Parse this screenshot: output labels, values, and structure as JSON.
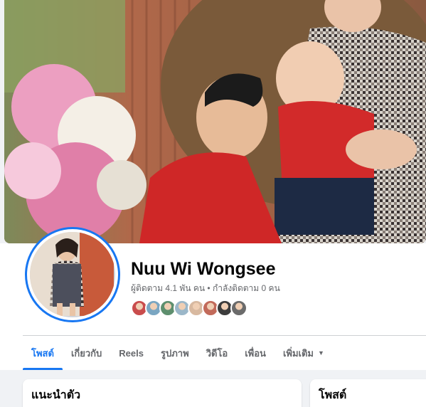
{
  "profile": {
    "name": "Nuu Wi Wongsee",
    "stats": "ผู้ติดตาม 4.1 พัน คน • กำลังติดตาม 0 คน",
    "friend_avatar_colors": [
      "#c94c4c",
      "#7aa6c2",
      "#5e8f6e",
      "#9bb7c9",
      "#d8b9a0",
      "#c26a5a",
      "#3c3c3c",
      "#6b6b6b"
    ]
  },
  "nav": {
    "tabs": [
      {
        "label": "โพสต์"
      },
      {
        "label": "เกี่ยวกับ"
      },
      {
        "label": "Reels"
      },
      {
        "label": "รูปภาพ"
      },
      {
        "label": "วิดีโอ"
      },
      {
        "label": "เพื่อน"
      },
      {
        "label": "เพิ่มเติม"
      }
    ],
    "active_tab": "โพสต์"
  },
  "cards": {
    "intro_title": "แนะนำตัว",
    "posts_title": "โพสต์"
  },
  "colors": {
    "accent": "#1877f2",
    "text_primary": "#050505",
    "text_secondary": "#65676b",
    "background": "#f0f2f5"
  }
}
